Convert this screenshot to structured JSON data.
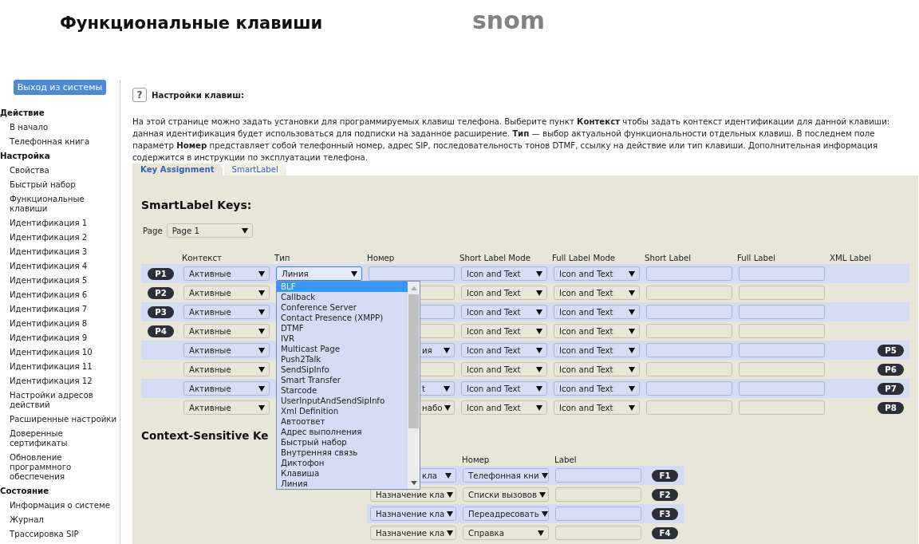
{
  "header": {
    "title": "Функциональные клавиши",
    "logo": "snom"
  },
  "sidebar": {
    "logout_button": "Выход из системы",
    "sections": [
      {
        "title": "Действие",
        "items": [
          "В начало",
          "Телефонная книга"
        ]
      },
      {
        "title": "Настройка",
        "items": [
          "Свойства",
          "Быстрый набор",
          "Функциональные клавиши",
          "Идентификация 1",
          "Идентификация 2",
          "Идентификация 3",
          "Идентификация 4",
          "Идентификация 5",
          "Идентификация 6",
          "Идентификация 7",
          "Идентификация 8",
          "Идентификация 9",
          "Идентификация 10",
          "Идентификация 11",
          "Идентификация 12",
          "Настройки адресов действий",
          "Расширенные настройки",
          "Доверенные сертификаты",
          "Обновление программного обеспечения"
        ]
      },
      {
        "title": "Состояние",
        "items": [
          "Информация о системе",
          "Журнал",
          "Трассировка SIP"
        ]
      }
    ]
  },
  "content": {
    "help_button": "?",
    "heading": "Настройки клавиш:",
    "intro": "На этой странице можно задать установки для программируемых клавиш телефона. Выберите пункт **Контекст** чтобы задать контекст идентификации для данной клавиши: данная идентификация будет использоваться для подписки на заданное расширение. **Тип** — выбор актуальной функциональности отдельных клавиш. В последнем поле параметр **Номер** представляет собой телефонный номер, адрес SIP, последовательность тонов DTMF, ссылку на действие или тип клавиши. Дополнительная информация содержится в инструкции по эксплуатации телефона.",
    "tabs": [
      {
        "label": "Key Assignment",
        "selected": true
      },
      {
        "label": "SmartLabel",
        "selected": false
      }
    ]
  },
  "smartlabel_keys": {
    "title": "SmartLabel Keys:",
    "page_label": "Page",
    "page_value": "Page 1",
    "columns": [
      "Контекст",
      "Тип",
      "Номер",
      "Short Label Mode",
      "Full Label Mode",
      "Short Label",
      "Full Label",
      "XML Label"
    ],
    "rows": [
      {
        "left_key": "P1",
        "context": "Активные",
        "type": {
          "value": "Линия",
          "open": true
        },
        "number": {
          "kind": "input",
          "partly_hidden": false
        },
        "short_mode": "Icon and Text",
        "full_mode": "Icon and Text"
      },
      {
        "left_key": "P2",
        "context": "Активные",
        "number": {
          "kind": "input",
          "partly_hidden": true
        },
        "short_mode": "Icon and Text",
        "full_mode": "Icon and Text"
      },
      {
        "left_key": "P3",
        "context": "Активные",
        "number": {
          "kind": "input",
          "partly_hidden": true
        },
        "short_mode": "Icon and Text",
        "full_mode": "Icon and Text"
      },
      {
        "left_key": "P4",
        "context": "Активные",
        "number": {
          "kind": "input",
          "partly_hidden": true
        },
        "short_mode": "Icon and Text",
        "full_mode": "Icon and Text"
      },
      {
        "right_key": "P5",
        "context": "Активные",
        "number": {
          "kind": "select",
          "value": "ия",
          "partly_hidden": true
        },
        "short_mode": "Icon and Text",
        "full_mode": "Icon and Text"
      },
      {
        "right_key": "P6",
        "context": "Активные",
        "number": {
          "kind": "input",
          "partly_hidden": true
        },
        "short_mode": "Icon and Text",
        "full_mode": "Icon and Text"
      },
      {
        "right_key": "P7",
        "context": "Активные",
        "number": {
          "kind": "select",
          "value": "t",
          "partly_hidden": true
        },
        "short_mode": "Icon and Text",
        "full_mode": "Icon and Text"
      },
      {
        "right_key": "P8",
        "context": "Активные",
        "number": {
          "kind": "select",
          "value": "набо",
          "partly_hidden": true
        },
        "short_mode": "Icon and Text",
        "full_mode": "Icon and Text"
      }
    ],
    "type_dropdown": {
      "options": [
        {
          "label": "BLF",
          "selected": true
        },
        {
          "label": "Callback",
          "selected": false
        },
        {
          "label": "Conference Server",
          "selected": false
        },
        {
          "label": "Contact Presence (XMPP)",
          "selected": false
        },
        {
          "label": "DTMF",
          "selected": false
        },
        {
          "label": "IVR",
          "selected": false
        },
        {
          "label": "Multicast Page",
          "selected": false
        },
        {
          "label": "Push2Talk",
          "selected": false
        },
        {
          "label": "SendSipInfo",
          "selected": false
        },
        {
          "label": "Smart Transfer",
          "selected": false
        },
        {
          "label": "Starcode",
          "selected": false
        },
        {
          "label": "UserInputAndSendSipInfo",
          "selected": false
        },
        {
          "label": "Xml Definition",
          "selected": false
        },
        {
          "label": "Автоответ",
          "selected": false
        },
        {
          "label": "Адрес выполнения",
          "selected": false
        },
        {
          "label": "Быстрый набор",
          "selected": false
        },
        {
          "label": "Внутренняя связь",
          "selected": false
        },
        {
          "label": "Диктофон",
          "selected": false
        },
        {
          "label": "Клавиша",
          "selected": false
        },
        {
          "label": "Линия",
          "selected": false
        }
      ]
    }
  },
  "context_sensitive_keys": {
    "title": "Context-Sensitive Ke",
    "columns": [
      "Номер",
      "Label"
    ],
    "rows": [
      {
        "key": "F1",
        "function": {
          "value": "кла",
          "partly_hidden": true
        },
        "number": "Телефонная кни"
      },
      {
        "key": "F2",
        "function": {
          "value": "Назначение кла",
          "partly_hidden": false
        },
        "number": "Списки вызовов"
      },
      {
        "key": "F3",
        "function": {
          "value": "Назначение кла",
          "partly_hidden": false
        },
        "number": "Переадресовать"
      },
      {
        "key": "F4",
        "function": {
          "value": "Назначение кла",
          "partly_hidden": false
        },
        "number": "Справка"
      }
    ]
  }
}
